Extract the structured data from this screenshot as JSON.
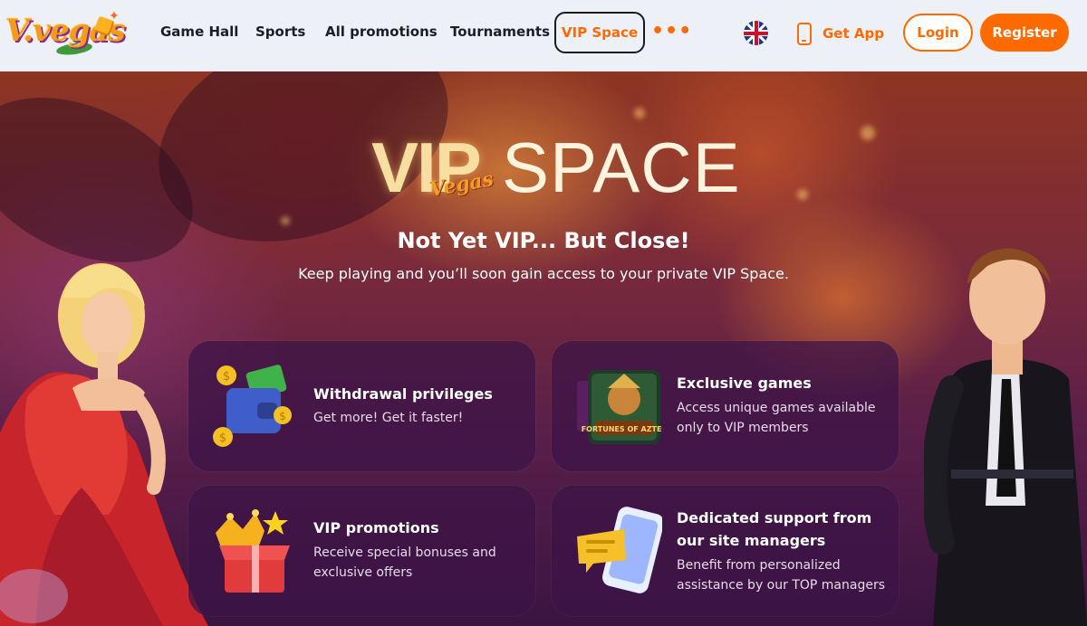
{
  "brand": {
    "logo_text": "V.vegas"
  },
  "nav": {
    "items": [
      {
        "label": "Game Hall"
      },
      {
        "label": "Sports"
      },
      {
        "label": "All promotions"
      },
      {
        "label": "Tournaments"
      }
    ],
    "active_label": "VIP Space",
    "more_label": "•••",
    "language_icon": "uk-flag-icon",
    "get_app_label": "Get App",
    "login_label": "Login",
    "register_label": "Register"
  },
  "colors": {
    "accent": "#ff6a00",
    "header_bg": "#eef0f7",
    "card_bg": "#3c1446"
  },
  "hero": {
    "logo_vip": "VIP",
    "logo_space": "SPACE",
    "logo_script": "Vegas",
    "title": "Not Yet VIP... But Close!",
    "subtitle": "Keep playing and you’ll soon gain access to your private VIP Space."
  },
  "cards": [
    {
      "title_lines": [
        "Withdrawal privileges"
      ],
      "desc_lines": [
        "Get more! Get it faster!"
      ],
      "icon": "wallet-coins-icon"
    },
    {
      "title_lines": [
        "Exclusive games"
      ],
      "desc_lines": [
        "Access unique games available",
        "only to VIP members"
      ],
      "icon": "game-thumbnail-icon",
      "game_label": "FORTUNES OF AZTEC"
    },
    {
      "title_lines": [
        "VIP promotions"
      ],
      "desc_lines": [
        "Receive special bonuses and",
        "exclusive offers"
      ],
      "icon": "gift-box-crown-icon"
    },
    {
      "title_lines": [
        "Dedicated support from",
        "our site managers"
      ],
      "desc_lines": [
        "Benefit from personalized",
        "assistance by our TOP managers"
      ],
      "icon": "phone-chat-icon"
    }
  ]
}
